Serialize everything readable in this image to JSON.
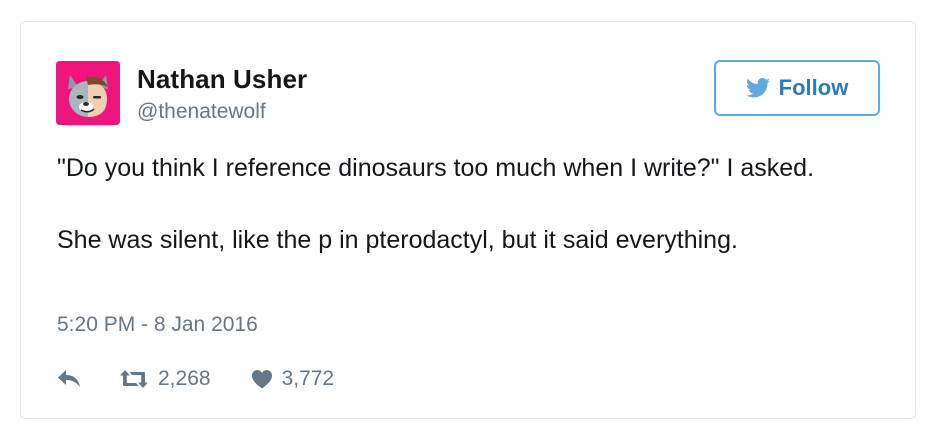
{
  "tweet": {
    "author_name": "Nathan Usher",
    "author_handle": "@thenatewolf",
    "follow_label": "Follow",
    "text_paragraphs": [
      "\"Do you think I reference dinosaurs too much when I write?\" I asked.",
      "She was silent, like the p in pterodactyl, but it said everything."
    ],
    "timestamp": "5:20 PM - 8 Jan 2016",
    "retweet_count": "2,268",
    "like_count": "3,772"
  },
  "icons": {
    "reply": "reply-icon",
    "retweet": "retweet-icon",
    "like": "heart-icon",
    "bird": "twitter-bird-icon"
  },
  "colors": {
    "avatar_bg": "#f0157e",
    "follow_accent": "#2b7bb9",
    "follow_border": "#5ea9dd",
    "meta_gray": "#657786",
    "text": "#14171a"
  }
}
